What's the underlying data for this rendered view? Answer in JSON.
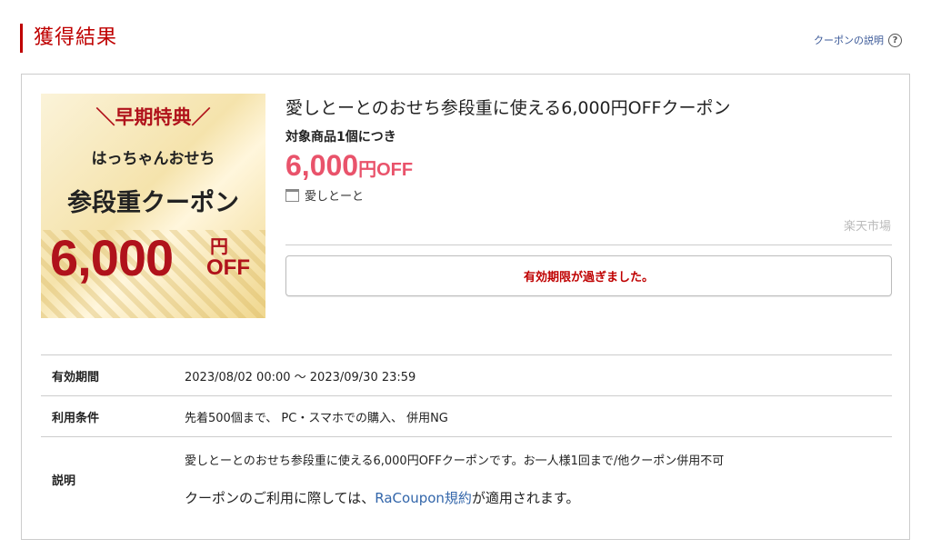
{
  "header": {
    "title": "獲得結果",
    "help_label": "クーポンの説明",
    "help_icon": "?"
  },
  "banner": {
    "top_text": "＼早期特典／",
    "sub_text": "はっちゃんおせち",
    "main_text": "参段重クーポン",
    "amount": "6,000",
    "unit": "円",
    "off": "OFF"
  },
  "coupon": {
    "name": "愛しとーとのおせち参段重に使える6,000円OFFクーポン",
    "target": "対象商品1個につき",
    "discount_amount": "6,000",
    "discount_unit": "円OFF",
    "shop": "愛しとーと",
    "market": "楽天市場",
    "status_button": "有効期限が過ぎました。"
  },
  "details": {
    "period_label": "有効期間",
    "period_value": "2023/08/02 00:00 〜 2023/09/30 23:59",
    "conditions_label": "利用条件",
    "conditions_value": "先着500個まで、 PC・スマホでの購入、 併用NG",
    "description_label": "説明",
    "description_line1": "愛しとーとのおせち参段重に使える6,000円OFFクーポンです。お一人様1回まで/他クーポン併用不可",
    "description_pre": "クーポンのご利用に際しては、",
    "description_link": "RaCoupon規約",
    "description_post": "が適用されます。"
  },
  "colors": {
    "accent": "#bf0000",
    "discount": "#e9536b",
    "link": "#3366aa"
  }
}
